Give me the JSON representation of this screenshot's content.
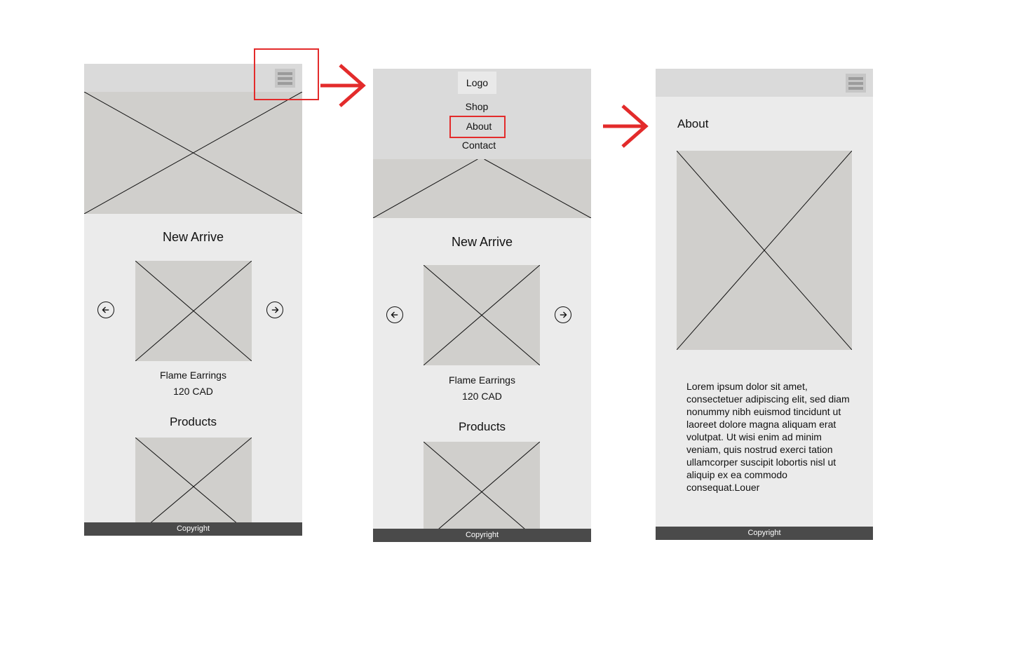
{
  "screens": {
    "home": {
      "new_arrive_title": "New Arrive",
      "product_name": "Flame Earrings",
      "product_price": "120 CAD",
      "products_title": "Products",
      "footer": "Copyright",
      "menu_icon": "hamburger-icon",
      "prev_icon": "arrow-left-circle-icon",
      "next_icon": "arrow-right-circle-icon"
    },
    "menu_open": {
      "logo": "Logo",
      "nav": [
        "Shop",
        "About",
        "Contact"
      ],
      "new_arrive_title": "New Arrive",
      "product_name": "Flame Earrings",
      "product_price": "120 CAD",
      "products_title": "Products",
      "footer": "Copyright"
    },
    "about": {
      "title": "About",
      "body": "Lorem ipsum dolor sit amet, consectetuer adipiscing elit, sed diam nonummy nibh euismod tincidunt ut laoreet dolore magna aliquam erat volutpat. Ut wisi enim ad minim veniam, quis nostrud exerci tation ullamcorper suscipit lobortis nisl ut aliquip ex ea commodo consequat.Louer",
      "footer": "Copyright",
      "menu_icon": "hamburger-icon"
    }
  },
  "colors": {
    "highlight": "#e32b2b",
    "screen_bg": "#ebebeb",
    "header_bg": "#dadada",
    "placeholder": "#d0cfcc",
    "footer_bg": "#4a4a4a"
  }
}
